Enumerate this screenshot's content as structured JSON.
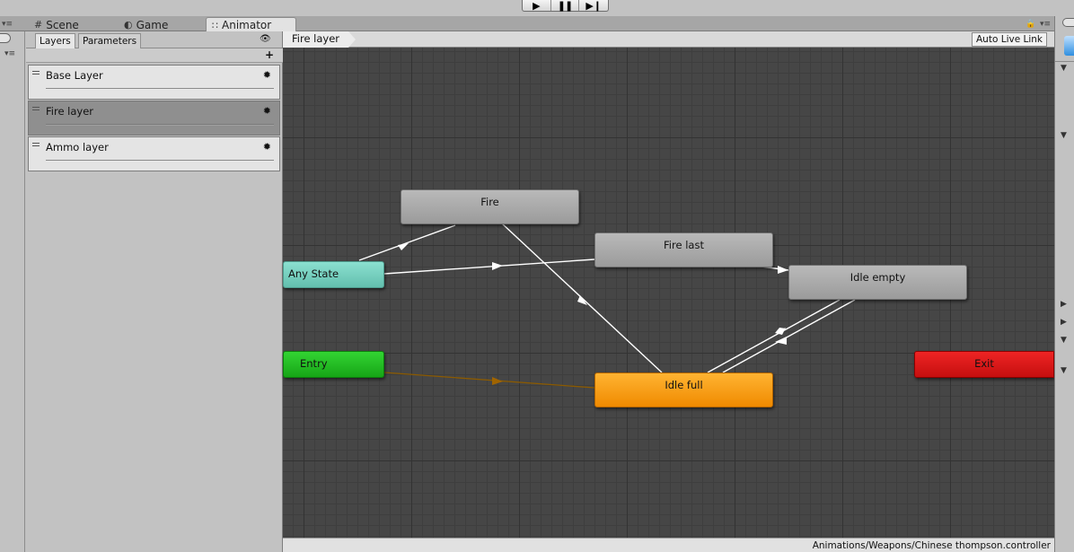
{
  "toolbar": {
    "play_icon": "play-icon",
    "pause_icon": "pause-icon",
    "step_icon": "step-icon"
  },
  "tabs": [
    {
      "label": "Scene",
      "icon": "#"
    },
    {
      "label": "Game",
      "icon": "pacman-icon"
    },
    {
      "label": "Animator",
      "icon": "animator-icon"
    }
  ],
  "layers_panel": {
    "tab_layers": "Layers",
    "tab_parameters": "Parameters",
    "add_label": "+",
    "layers": [
      {
        "name": "Base Layer"
      },
      {
        "name": "Fire layer"
      },
      {
        "name": "Ammo layer"
      }
    ]
  },
  "graph": {
    "breadcrumb": "Fire layer",
    "auto_live_link": "Auto Live Link",
    "states": {
      "fire": "Fire",
      "fire_last": "Fire last",
      "any_state": "Any State",
      "idle_empty": "Idle empty",
      "entry": "Entry",
      "exit": "Exit",
      "idle_full": "Idle full"
    }
  },
  "status_bar": {
    "path": "Animations/Weapons/Chinese thompson.controller"
  },
  "colors": {
    "graph_bg": "#464646",
    "state_default": "#f08a00",
    "entry": "#16a516",
    "exit": "#c50f0f",
    "any_state": "#63bfae"
  }
}
